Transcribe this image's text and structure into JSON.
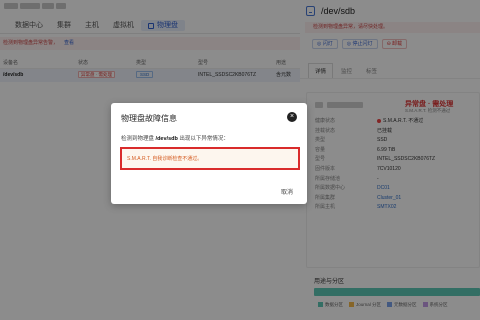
{
  "nav": {
    "tabs": [
      "数据中心",
      "集群",
      "主机",
      "虚拟机"
    ],
    "active_tab": "物理盘"
  },
  "left_alert": {
    "text": "检测到物理盘异常告警，",
    "link": "查看"
  },
  "table": {
    "headers": [
      "设备名",
      "状态",
      "类型",
      "型号",
      "用途"
    ],
    "row": {
      "device": "/dev/sdb",
      "status": "异常盘 · 需处理",
      "type": "SSD",
      "model": "INTEL_SSDSC2KB076TZ",
      "usage": "含元数"
    }
  },
  "drawer": {
    "title": "/dev/sdb",
    "alert": "检测到物理盘异常，请尽快处理。",
    "buttons": [
      "闪灯",
      "停止闪灯",
      "卸载"
    ],
    "tabs": [
      "详情",
      "监控",
      "标签"
    ],
    "state_main": "异常盘 · 需处理",
    "state_sub": "S.M.A.R.T. 检测不通过",
    "fields": [
      {
        "k": "健康状态",
        "v": "S.M.A.R.T. 不通过"
      },
      {
        "k": "挂载状态",
        "v": "已挂载"
      },
      {
        "k": "类型",
        "v": "SSD"
      },
      {
        "k": "容量",
        "v": "6.99 TiB"
      },
      {
        "k": "型号",
        "v": "INTEL_SSDSC2KB076TZ"
      },
      {
        "k": "固件版本",
        "v": "7CV10120"
      },
      {
        "k": "所属存储池",
        "v": "-"
      },
      {
        "k": "所属数据中心",
        "v": "DC01"
      },
      {
        "k": "所属集群",
        "v": "Cluster_01"
      },
      {
        "k": "所属主机",
        "v": "SMTX02"
      }
    ],
    "usage_title": "用途与分区",
    "legend": [
      "数据分区",
      "Journal 分区",
      "元数据分区",
      "系统分区"
    ]
  },
  "modal": {
    "title": "物理盘故障信息",
    "desc_prefix": "检测到物理盘",
    "desc_disk": "/dev/sdb",
    "desc_suffix": "出现以下异常情况：",
    "error": "S.M.A.R.T. 自我诊断检查不通过。",
    "cancel": "取消"
  },
  "colors": {
    "accent": "#2f5fd0",
    "danger": "#d92b2b",
    "usage_bar": "#5dc9b7"
  }
}
